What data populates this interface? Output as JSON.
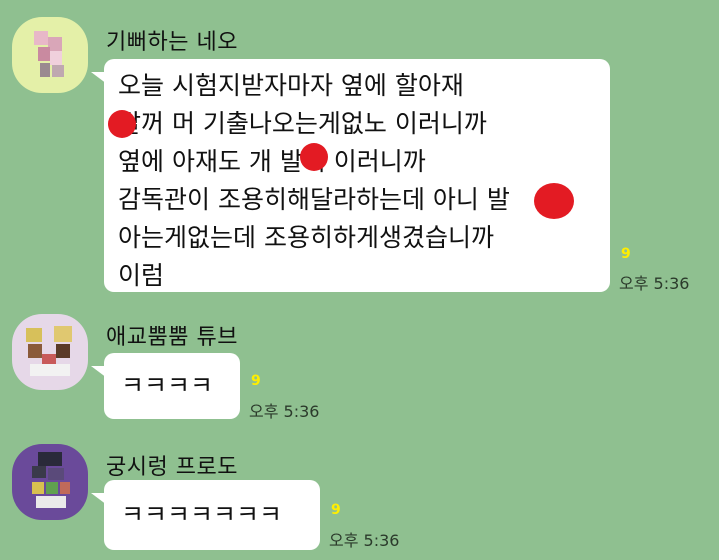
{
  "messages": [
    {
      "sender": "기뻐하는 네오",
      "lines": [
        "오늘 시험지받자마자 옆에 할아재",
        " 발꺼 머 기출나오는게없노 이러니까",
        "옆에 아재도 개   발꺼 이러니까",
        "감독관이 조용히해달라하는데 아니   발",
        "아는게없는데 조용히하게생겼습니까",
        "이럼"
      ],
      "unread": "9",
      "time": "오후 5:36"
    },
    {
      "sender": "애교뿜뿜 튜브",
      "lines": [
        "ㅋㅋㅋㅋ"
      ],
      "unread": "9",
      "time": "오후 5:36"
    },
    {
      "sender": "궁시렁 프로도",
      "lines": [
        "ㅋㅋㅋㅋㅋㅋㅋ"
      ],
      "unread": "9",
      "time": "오후 5:36"
    }
  ],
  "colors": {
    "background": "#8fc090",
    "bubble": "#ffffff",
    "unread": "#ffee00",
    "censor_dot": "#e31b23"
  }
}
